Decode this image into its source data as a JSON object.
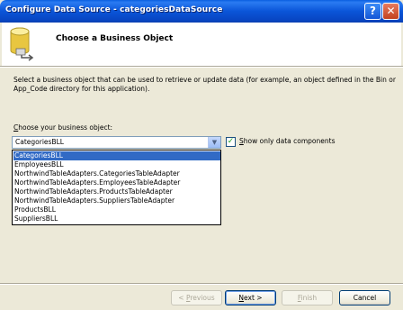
{
  "window": {
    "title": "Configure Data Source - categoriesDataSource"
  },
  "title_buttons": {
    "help": "?",
    "close": "✕"
  },
  "header": {
    "title": "Choose a Business Object"
  },
  "description": "Select a business object that can be used to retrieve or update data (for example, an object defined in the Bin or App_Code directory for this application).",
  "choose_label": {
    "accel": "C",
    "rest": "hoose your business object:"
  },
  "combo": {
    "value": "CategoriesBLL",
    "arrow": "▼"
  },
  "checkbox": {
    "checked": true,
    "mark": "✓",
    "accel": "S",
    "rest": "how only data components"
  },
  "dropdown": {
    "items": [
      "CategoriesBLL",
      "EmployeesBLL",
      "NorthwindTableAdapters.CategoriesTableAdapter",
      "NorthwindTableAdapters.EmployeesTableAdapter",
      "NorthwindTableAdapters.ProductsTableAdapter",
      "NorthwindTableAdapters.SuppliersTableAdapter",
      "ProductsBLL",
      "SuppliersBLL"
    ],
    "selected_index": 0
  },
  "buttons": {
    "previous": {
      "lt": "< ",
      "accel": "P",
      "rest": "revious"
    },
    "next": {
      "accel": "N",
      "rest": "ext >"
    },
    "finish": {
      "accel": "F",
      "rest": "inish"
    },
    "cancel": "Cancel"
  }
}
